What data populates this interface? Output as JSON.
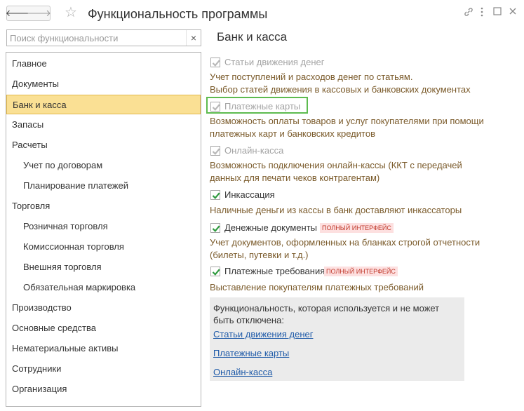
{
  "window": {
    "title": "Функциональность программы",
    "back_icon": "arrow-left",
    "forward_icon": "arrow-right",
    "favorite_icon": "star",
    "link_icon": "link",
    "more_icon": "vertical-dots",
    "maximize_icon": "square",
    "close_icon": "x"
  },
  "search": {
    "placeholder": "Поиск функциональности",
    "clear_label": "×"
  },
  "sidebar": {
    "items": [
      {
        "label": "Главное",
        "level": 0,
        "selected": false
      },
      {
        "label": "Документы",
        "level": 0,
        "selected": false
      },
      {
        "label": "Банк и касса",
        "level": 0,
        "selected": true
      },
      {
        "label": "Запасы",
        "level": 0,
        "selected": false
      },
      {
        "label": "Расчеты",
        "level": 0,
        "selected": false
      },
      {
        "label": "Учет по договорам",
        "level": 1,
        "selected": false
      },
      {
        "label": "Планирование платежей",
        "level": 1,
        "selected": false
      },
      {
        "label": "Торговля",
        "level": 0,
        "selected": false
      },
      {
        "label": "Розничная торговля",
        "level": 1,
        "selected": false
      },
      {
        "label": "Комиссионная торговля",
        "level": 1,
        "selected": false
      },
      {
        "label": "Внешняя торговля",
        "level": 1,
        "selected": false
      },
      {
        "label": "Обязательная маркировка",
        "level": 1,
        "selected": false
      },
      {
        "label": "Производство",
        "level": 0,
        "selected": false
      },
      {
        "label": "Основные средства",
        "level": 0,
        "selected": false
      },
      {
        "label": "Нематериальные активы",
        "level": 0,
        "selected": false
      },
      {
        "label": "Сотрудники",
        "level": 0,
        "selected": false
      },
      {
        "label": "Организация",
        "level": 0,
        "selected": false
      }
    ]
  },
  "section": {
    "title": "Банк и касса",
    "options": [
      {
        "label": "Статьи движения денег",
        "checked": true,
        "disabled": true,
        "badge": "",
        "description": [
          "Учет поступлений и расходов денег по статьям.",
          "Выбор статей движения в кассовых и банковских документах"
        ]
      },
      {
        "label": "Платежные карты",
        "checked": true,
        "disabled": true,
        "badge": "",
        "description": [
          "Возможность оплаты товаров и услуг покупателями при помощи",
          "платежных карт и банковских кредитов"
        ]
      },
      {
        "label": "Онлайн-касса",
        "checked": true,
        "disabled": true,
        "badge": "",
        "description": [
          "Возможность подключения онлайн-кассы (ККТ с передачей",
          "данных для печати чеков контрагентам)"
        ]
      },
      {
        "label": "Инкассация",
        "checked": true,
        "disabled": false,
        "badge": "",
        "description": [
          "Наличные деньги из кассы в банк доставляют инкассаторы"
        ]
      },
      {
        "label": "Денежные документы",
        "checked": true,
        "disabled": false,
        "badge": "ПОЛНЫЙ ИНТЕРФЕЙС",
        "description": [
          "Учет документов, оформленных на бланках строгой отчетности",
          "(билеты, путевки и т.д.)"
        ]
      },
      {
        "label": "Платежные требования",
        "checked": true,
        "disabled": false,
        "badge": "ПОЛНЫЙ ИНТЕРФЕЙС",
        "description": [
          "Выставление покупателям платежных требований"
        ]
      }
    ],
    "info": {
      "text": "Функциональность, которая используется и не может быть отключена:",
      "links": [
        "Статьи движения денег",
        "Платежные карты",
        "Онлайн-касса"
      ]
    }
  },
  "colors": {
    "selected_bg": "#fae094",
    "selected_border": "#e2b84b",
    "highlight_border": "#5dbb4f",
    "description_text": "#7a5a2a",
    "badge_bg": "#fde0e0",
    "badge_text": "#c0392b",
    "link": "#1e5aa8",
    "check_enabled": "#2e9a3e",
    "check_disabled": "#b8b8b8"
  }
}
